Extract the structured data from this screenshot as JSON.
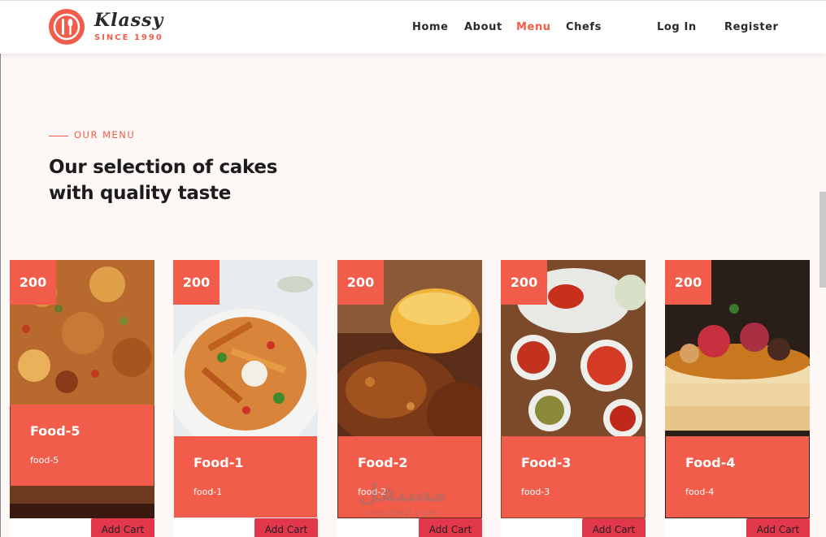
{
  "header": {
    "brand_name": "Klassy",
    "brand_since": "SINCE 1990",
    "nav": [
      {
        "label": "Home",
        "active": false
      },
      {
        "label": "About",
        "active": false
      },
      {
        "label": "Menu",
        "active": true
      },
      {
        "label": "Chefs",
        "active": false
      },
      {
        "label": "Log In",
        "active": false
      },
      {
        "label": "Register",
        "active": false
      }
    ]
  },
  "section": {
    "eyebrow": "OUR MENU",
    "heading_line1": "Our selection of cakes",
    "heading_line2": "with quality taste"
  },
  "cards": [
    {
      "price": "200",
      "title": "Food-5",
      "subtitle": "food-5",
      "button": "Add Cart",
      "image": "pizza"
    },
    {
      "price": "200",
      "title": "Food-1",
      "subtitle": "food-1",
      "button": "Add Cart",
      "image": "fries"
    },
    {
      "price": "200",
      "title": "Food-2",
      "subtitle": "food-2",
      "button": "Add Cart",
      "image": "chicken"
    },
    {
      "price": "200",
      "title": "Food-3",
      "subtitle": "food-3",
      "button": "Add Cart",
      "image": "curry"
    },
    {
      "price": "200",
      "title": "Food-4",
      "subtitle": "food-4",
      "button": "Add Cart",
      "image": "pancakes"
    }
  ],
  "watermark": {
    "text": "مستقل",
    "sub": "mostaql.com"
  },
  "colors": {
    "accent": "#f25c4a",
    "button": "#e2364a",
    "background": "#fdf7f6"
  }
}
